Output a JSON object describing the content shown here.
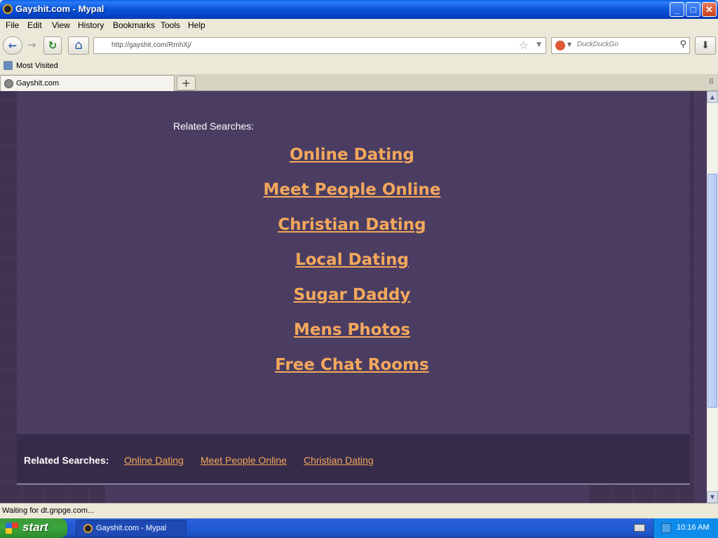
{
  "window": {
    "title": "Gayshit.com - Mypal",
    "controls": {
      "minimize": "_",
      "maximize": "□",
      "close": "✕"
    }
  },
  "menubar": {
    "items": [
      "File",
      "Edit",
      "View",
      "History",
      "Bookmarks",
      "Tools",
      "Help"
    ]
  },
  "navbar": {
    "back_glyph": "←",
    "forward_glyph": "→",
    "reload_glyph": "↻",
    "home_glyph": "⌂",
    "url": "http://gayshit.com/RmhXj/",
    "star_glyph": "☆",
    "search_placeholder": "DuckDuckGo",
    "search_glyph": "⚲",
    "download_glyph": "⬇"
  },
  "bookmarks": {
    "items": [
      "Most Visited"
    ]
  },
  "tabs": {
    "items": [
      {
        "label": "Gayshit.com",
        "active": true
      }
    ],
    "new_tab": "+",
    "list_glyph": "⠿"
  },
  "page": {
    "related_header": "Related Searches:",
    "links": [
      "Online Dating",
      "Meet People Online",
      "Christian Dating",
      "Local Dating",
      "Sugar Daddy",
      "Mens Photos",
      "Free Chat Rooms"
    ],
    "footer": {
      "label": "Related Searches:",
      "links": [
        "Online Dating",
        "Meet People Online",
        "Christian Dating"
      ]
    },
    "link_color": "#f4a85c",
    "background_color": "#493a5e"
  },
  "statusbar": {
    "text": "Waiting for dt.gnpge.com..."
  },
  "taskbar": {
    "start_label": "start",
    "task_label": "Gayshit.com - Mypal",
    "clock": "10:16 AM"
  }
}
